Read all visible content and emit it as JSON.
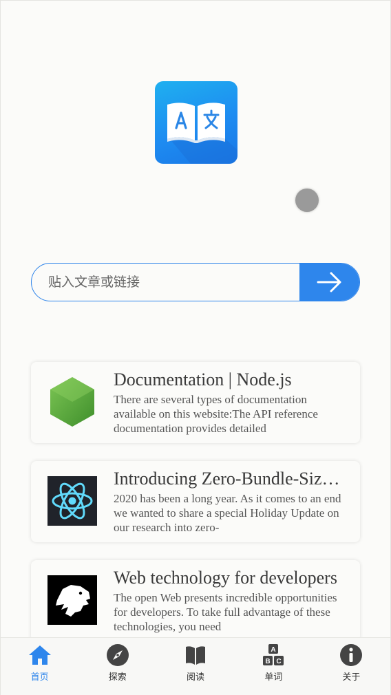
{
  "search": {
    "placeholder": "贴入文章或链接"
  },
  "articles": [
    {
      "title": "Documentation | Node.js",
      "description": "There are several types of documentation available on this website:The API reference documentation provides detailed",
      "icon": "nodejs-logo-icon"
    },
    {
      "title": "Introducing Zero-Bundle-Size React Server Components",
      "description": "2020 has been a long year. As it comes to an end we wanted to share a special Holiday Update on our research into zero-",
      "icon": "react-logo-icon"
    },
    {
      "title": "Web technology for developers",
      "description": "The open Web presents incredible opportunities for developers. To take full advantage of these technologies, you need",
      "icon": "mdn-dino-logo-icon"
    }
  ],
  "tabs": [
    {
      "label": "首页",
      "icon": "home-icon",
      "active": true
    },
    {
      "label": "探索",
      "icon": "compass-icon",
      "active": false
    },
    {
      "label": "阅读",
      "icon": "book-icon",
      "active": false
    },
    {
      "label": "单词",
      "icon": "abc-blocks-icon",
      "active": false
    },
    {
      "label": "关于",
      "icon": "info-icon",
      "active": false
    }
  ],
  "colors": {
    "accent": "#2e86ec",
    "background": "#fbfbf9",
    "logo_gradient_top": "#1fb0f0",
    "logo_gradient_bottom": "#1976e6"
  }
}
